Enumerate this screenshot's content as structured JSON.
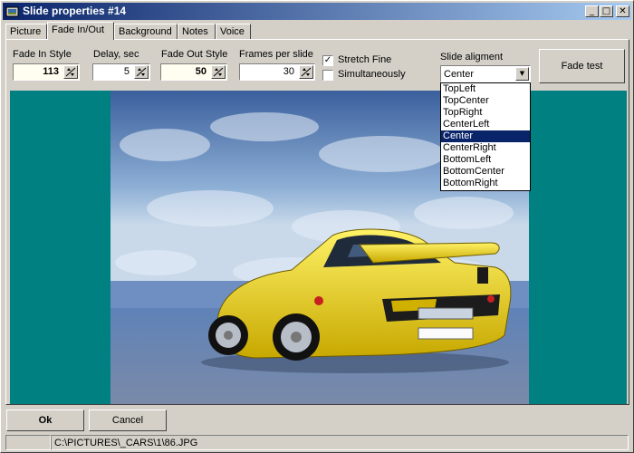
{
  "window": {
    "title": "Slide properties #14",
    "controls": {
      "minimize": "_",
      "maximize": "□",
      "close": "✕"
    }
  },
  "tabs": [
    {
      "label": "Picture",
      "active": false
    },
    {
      "label": "Fade In/Out",
      "active": true
    },
    {
      "label": "Background",
      "active": false
    },
    {
      "label": "Notes",
      "active": false
    },
    {
      "label": "Voice",
      "active": false
    }
  ],
  "fade": {
    "fade_in_style": {
      "label": "Fade In Style",
      "value": "113"
    },
    "delay": {
      "label": "Delay, sec",
      "value": "5"
    },
    "fade_out_style": {
      "label": "Fade Out Style",
      "value": "50"
    },
    "frames_per_slide": {
      "label": "Frames per slide",
      "value": "30"
    },
    "stretch_fine": {
      "label": "Stretch Fine",
      "checked": true,
      "mark": "✓"
    },
    "simultaneously": {
      "label": "Simultaneously",
      "checked": false
    },
    "slide_alignment": {
      "label": "Slide aligment",
      "value": "Center",
      "options": [
        "TopLeft",
        "TopCenter",
        "TopRight",
        "CenterLeft",
        "Center",
        "CenterRight",
        "BottomLeft",
        "BottomCenter",
        "BottomRight"
      ],
      "selected_index": 4
    },
    "fade_test_label": "Fade test"
  },
  "preview": {
    "background_color": "#008080",
    "image": "yellow-porsche-car-photo"
  },
  "footer": {
    "ok_label": "Ok",
    "cancel_label": "Cancel",
    "status_path": "C:\\PICTURES\\_CARS\\1\\86.JPG"
  }
}
